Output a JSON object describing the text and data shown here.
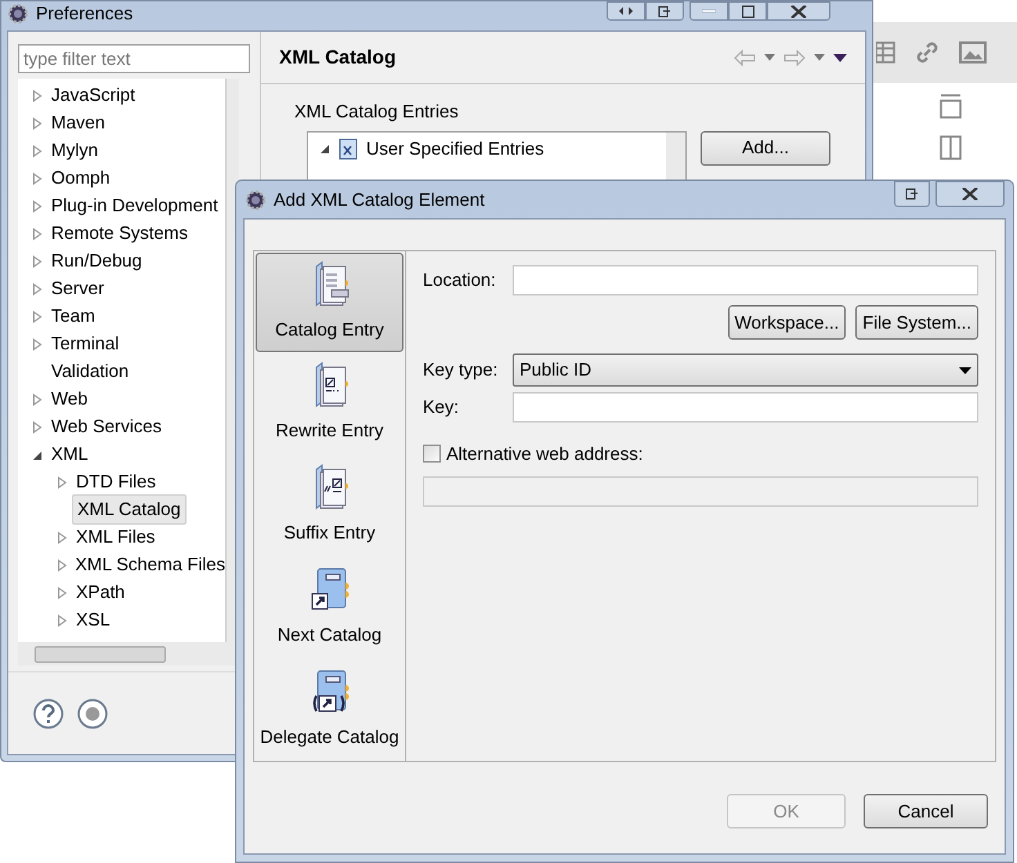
{
  "preferences": {
    "title": "Preferences",
    "filter_placeholder": "type filter text",
    "tree": [
      {
        "label": "JavaScript",
        "expanded": false,
        "selected": false
      },
      {
        "label": "Maven",
        "expanded": false,
        "selected": false
      },
      {
        "label": "Mylyn",
        "expanded": false,
        "selected": false
      },
      {
        "label": "Oomph",
        "expanded": false,
        "selected": false
      },
      {
        "label": "Plug-in Development",
        "expanded": false,
        "selected": false
      },
      {
        "label": "Remote Systems",
        "expanded": false,
        "selected": false
      },
      {
        "label": "Run/Debug",
        "expanded": false,
        "selected": false
      },
      {
        "label": "Server",
        "expanded": false,
        "selected": false
      },
      {
        "label": "Team",
        "expanded": false,
        "selected": false
      },
      {
        "label": "Terminal",
        "expanded": false,
        "selected": false
      },
      {
        "label": "Validation",
        "selected": false
      },
      {
        "label": "Web",
        "expanded": false,
        "selected": false
      },
      {
        "label": "Web Services",
        "expanded": false,
        "selected": false
      },
      {
        "label": "XML",
        "expanded": true,
        "selected": false,
        "children": [
          {
            "label": "DTD Files",
            "expanded": false,
            "selected": false
          },
          {
            "label": "XML Catalog",
            "selected": true
          },
          {
            "label": "XML Files",
            "expanded": false,
            "selected": false
          },
          {
            "label": "XML Schema Files",
            "expanded": false,
            "selected": false
          },
          {
            "label": "XPath",
            "expanded": false,
            "selected": false
          },
          {
            "label": "XSL",
            "expanded": false,
            "selected": false
          }
        ]
      }
    ],
    "page_title": "XML Catalog",
    "group_label": "XML Catalog Entries",
    "entries": [
      {
        "label": "User Specified Entries",
        "expanded": true
      }
    ],
    "add_button": "Add..."
  },
  "dialog": {
    "title": "Add XML Catalog Element",
    "types": [
      {
        "label": "Catalog Entry",
        "kind": "entry",
        "selected": true
      },
      {
        "label": "Rewrite Entry",
        "kind": "rewrite",
        "selected": false
      },
      {
        "label": "Suffix Entry",
        "kind": "suffix",
        "selected": false
      },
      {
        "label": "Next Catalog",
        "kind": "next",
        "selected": false
      },
      {
        "label": "Delegate Catalog",
        "kind": "delegate",
        "selected": false
      }
    ],
    "location_label": "Location:",
    "browse_buttons": [
      "Workspace...",
      "File System..."
    ],
    "key_type_label": "Key type:",
    "key_type_value": "Public ID",
    "key_label": "Key:",
    "alt_checkbox": {
      "label": "Alternative web address:",
      "checked": false
    },
    "footer_buttons": [
      {
        "label": "OK",
        "disabled": true
      },
      {
        "label": "Cancel",
        "disabled": false
      }
    ]
  }
}
